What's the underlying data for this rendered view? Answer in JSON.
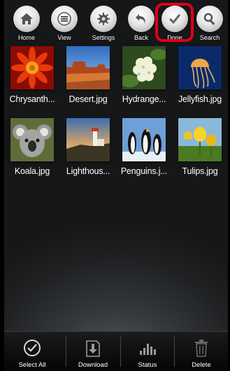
{
  "toolbar": {
    "buttons": [
      {
        "id": "home",
        "label": "Home",
        "icon": "home-icon"
      },
      {
        "id": "view",
        "label": "View",
        "icon": "list-icon"
      },
      {
        "id": "settings",
        "label": "Settings",
        "icon": "gear-icon"
      },
      {
        "id": "back",
        "label": "Back",
        "icon": "back-arrow-icon"
      },
      {
        "id": "done",
        "label": "Done",
        "icon": "checkmark-icon"
      },
      {
        "id": "search",
        "label": "Search",
        "icon": "search-icon"
      }
    ],
    "highlight_color": "#e0001a"
  },
  "files": [
    {
      "name": "Chrysanth...",
      "thumb": "chrysanthemum"
    },
    {
      "name": "Desert.jpg",
      "thumb": "desert"
    },
    {
      "name": "Hydrange...",
      "thumb": "hydrangeas"
    },
    {
      "name": "Jellyfish.jpg",
      "thumb": "jellyfish"
    },
    {
      "name": "Koala.jpg",
      "thumb": "koala"
    },
    {
      "name": "Lighthous...",
      "thumb": "lighthouse"
    },
    {
      "name": "Penguins.j...",
      "thumb": "penguins"
    },
    {
      "name": "Tulips.jpg",
      "thumb": "tulips"
    }
  ],
  "bottombar": {
    "buttons": [
      {
        "id": "select-all",
        "label": "Select All",
        "icon": "check-circle-icon"
      },
      {
        "id": "download",
        "label": "Download",
        "icon": "download-icon"
      },
      {
        "id": "status",
        "label": "Status",
        "icon": "signal-bars-icon"
      },
      {
        "id": "delete",
        "label": "Delete",
        "icon": "trash-icon"
      }
    ]
  }
}
